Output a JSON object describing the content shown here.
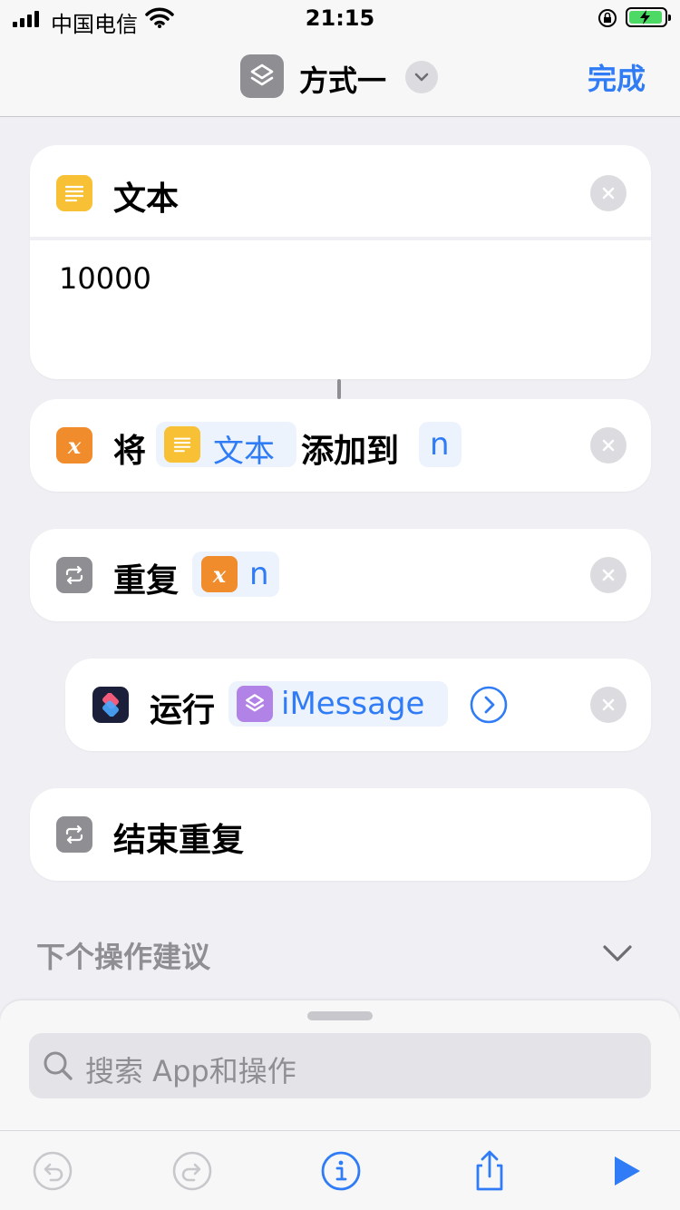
{
  "status": {
    "carrier": "中国电信",
    "time": "21:15"
  },
  "nav": {
    "title": "方式一",
    "done": "完成"
  },
  "actions": {
    "text": {
      "title": "文本",
      "value": "10000"
    },
    "add": {
      "verb": "将",
      "var_label": "文本",
      "connector": "添加到",
      "target": "n"
    },
    "repeat": {
      "title": "重复",
      "var_label": "n"
    },
    "run": {
      "title": "运行",
      "shortcut": "iMessage"
    },
    "end": {
      "title": "结束重复"
    }
  },
  "suggestions": {
    "title": "下个操作建议"
  },
  "search": {
    "placeholder": "搜索 App和操作"
  },
  "colors": {
    "accent": "#2f7cf6",
    "text_icon": "#f7c035",
    "variable_icon": "#f08c2b",
    "control_icon": "#8e8e93",
    "shortcut_icon": "#b283e6",
    "battery": "#4cd964"
  },
  "icons": {
    "text": "text-lines-icon",
    "variable": "variable-x-icon",
    "repeat": "repeat-icon",
    "shortcuts": "shortcuts-app-icon",
    "undo": "undo-icon",
    "redo": "redo-icon",
    "info": "info-icon",
    "share": "share-icon",
    "play": "play-icon"
  }
}
